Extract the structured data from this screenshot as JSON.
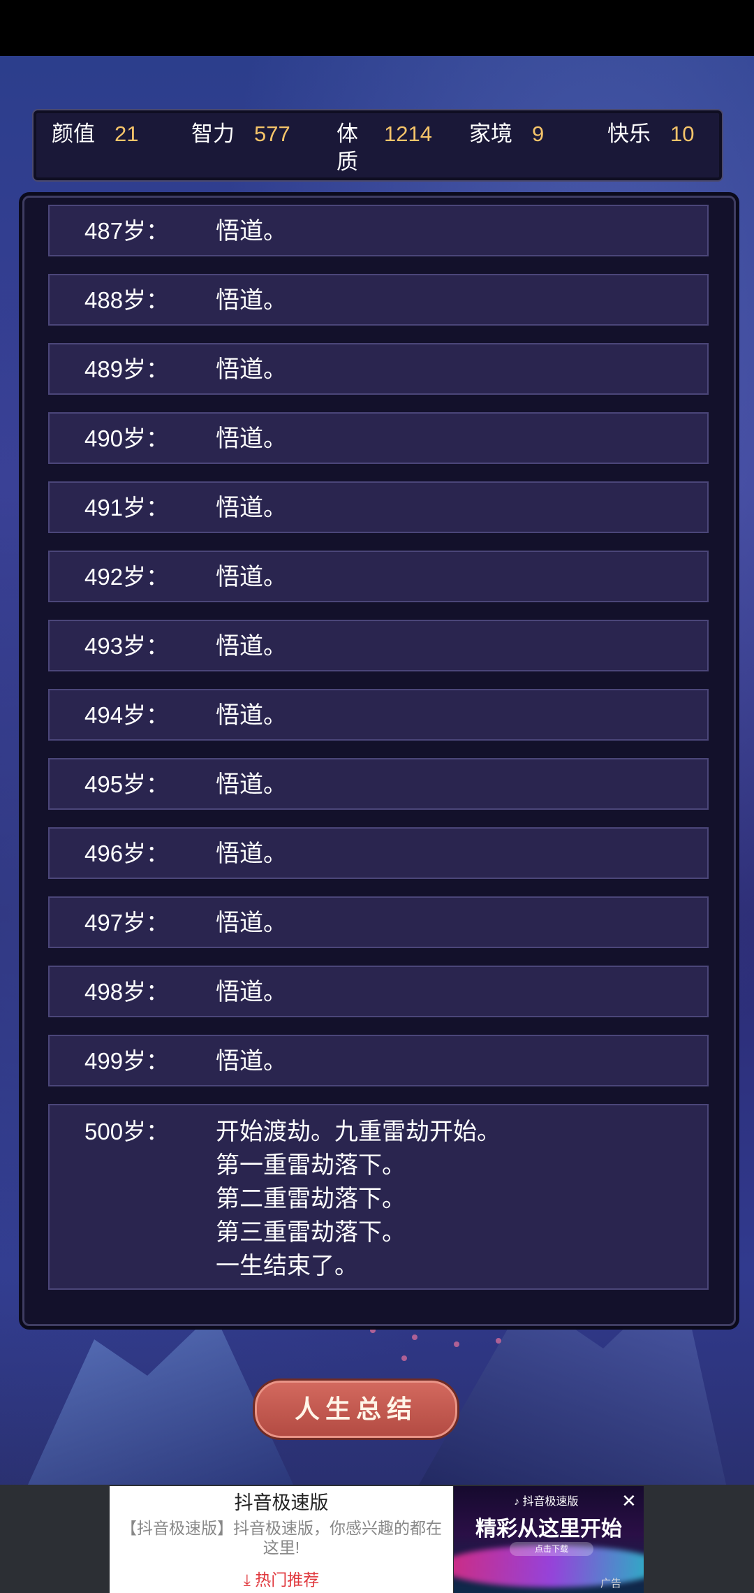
{
  "stats": [
    {
      "label": "颜值",
      "value": "21"
    },
    {
      "label": "智力",
      "value": "577"
    },
    {
      "label": "体质",
      "value": "1214"
    },
    {
      "label": "家境",
      "value": "9"
    },
    {
      "label": "快乐",
      "value": "10"
    }
  ],
  "events": [
    {
      "age": "487岁：",
      "text": "悟道。"
    },
    {
      "age": "488岁：",
      "text": "悟道。"
    },
    {
      "age": "489岁：",
      "text": "悟道。"
    },
    {
      "age": "490岁：",
      "text": "悟道。"
    },
    {
      "age": "491岁：",
      "text": "悟道。"
    },
    {
      "age": "492岁：",
      "text": "悟道。"
    },
    {
      "age": "493岁：",
      "text": "悟道。"
    },
    {
      "age": "494岁：",
      "text": "悟道。"
    },
    {
      "age": "495岁：",
      "text": "悟道。"
    },
    {
      "age": "496岁：",
      "text": "悟道。"
    },
    {
      "age": "497岁：",
      "text": "悟道。"
    },
    {
      "age": "498岁：",
      "text": "悟道。"
    },
    {
      "age": "499岁：",
      "text": "悟道。"
    },
    {
      "age": "500岁：",
      "text": "开始渡劫。九重雷劫开始。\n第一重雷劫落下。\n第二重雷劫落下。\n第三重雷劫落下。\n一生结束了。"
    }
  ],
  "summary_button": "人生总结",
  "ad": {
    "title": "抖音极速版",
    "description": "【抖音极速版】抖音极速版，你感兴趣的都在这里!",
    "cta": "⤓ 热门推荐",
    "brand": "♪ 抖音极速版",
    "slogan": "精彩从这里开始",
    "download": "点击下载",
    "tag": "广告",
    "close": "✕"
  }
}
